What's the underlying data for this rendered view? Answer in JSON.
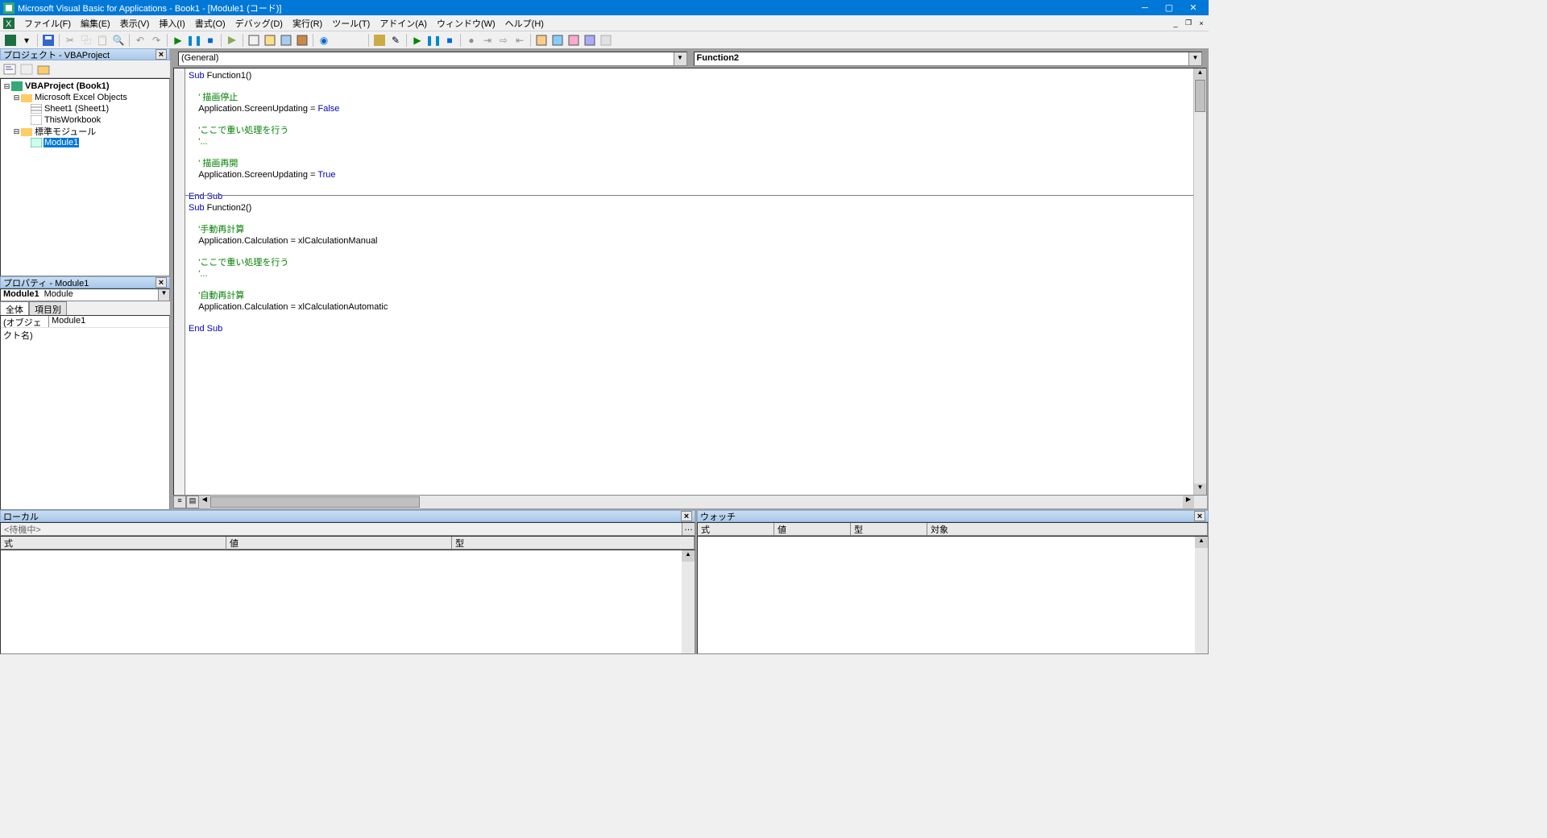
{
  "title": "Microsoft Visual Basic for Applications - Book1 - [Module1 (コード)]",
  "menu": [
    "ファイル(F)",
    "編集(E)",
    "表示(V)",
    "挿入(I)",
    "書式(O)",
    "デバッグ(D)",
    "実行(R)",
    "ツール(T)",
    "アドイン(A)",
    "ウィンドウ(W)",
    "ヘルプ(H)"
  ],
  "project": {
    "title": "プロジェクト - VBAProject",
    "root": "VBAProject (Book1)",
    "folder1": "Microsoft Excel Objects",
    "sheet1": "Sheet1 (Sheet1)",
    "thiswb": "ThisWorkbook",
    "folder2": "標準モジュール",
    "module": "Module1"
  },
  "props": {
    "title": "プロパティ - Module1",
    "name": "Module1",
    "type": "Module",
    "tab1": "全体",
    "tab2": "項目別",
    "row_key": "(オブジェクト名)",
    "row_val": "Module1"
  },
  "combo": {
    "left": "(General)",
    "right": "Function2"
  },
  "code_lines": [
    {
      "t": "kw",
      "s": "Sub"
    },
    {
      "t": "p",
      "s": " Function1()"
    },
    {
      "br": 1
    },
    {
      "br": 1
    },
    {
      "t": "sp",
      "s": "    "
    },
    {
      "t": "cm",
      "s": "' 描画停止"
    },
    {
      "br": 1
    },
    {
      "t": "sp",
      "s": "    "
    },
    {
      "t": "p",
      "s": "Application.ScreenUpdating = "
    },
    {
      "t": "kw",
      "s": "False"
    },
    {
      "br": 1
    },
    {
      "br": 1
    },
    {
      "t": "sp",
      "s": "    "
    },
    {
      "t": "cm",
      "s": "'ここで重い処理を行う"
    },
    {
      "br": 1
    },
    {
      "t": "sp",
      "s": "    "
    },
    {
      "t": "cm",
      "s": "'..."
    },
    {
      "br": 1
    },
    {
      "br": 1
    },
    {
      "t": "sp",
      "s": "    "
    },
    {
      "t": "cm",
      "s": "' 描画再開"
    },
    {
      "br": 1
    },
    {
      "t": "sp",
      "s": "    "
    },
    {
      "t": "p",
      "s": "Application.ScreenUpdating = "
    },
    {
      "t": "kw",
      "s": "True"
    },
    {
      "br": 1
    },
    {
      "br": 1
    },
    {
      "t": "kw",
      "s": "End Sub"
    },
    {
      "br": 1,
      "sep": 1
    },
    {
      "t": "kw",
      "s": "Sub"
    },
    {
      "t": "p",
      "s": " Function2()"
    },
    {
      "br": 1
    },
    {
      "br": 1
    },
    {
      "t": "sp",
      "s": "    "
    },
    {
      "t": "cm",
      "s": "'手動再計算"
    },
    {
      "br": 1
    },
    {
      "t": "sp",
      "s": "    "
    },
    {
      "t": "p",
      "s": "Application.Calculation = xlCalculationManual"
    },
    {
      "br": 1
    },
    {
      "br": 1
    },
    {
      "t": "sp",
      "s": "    "
    },
    {
      "t": "cm",
      "s": "'ここで重い処理を行う"
    },
    {
      "br": 1
    },
    {
      "t": "sp",
      "s": "    "
    },
    {
      "t": "cm",
      "s": "'..."
    },
    {
      "br": 1
    },
    {
      "br": 1
    },
    {
      "t": "sp",
      "s": "    "
    },
    {
      "t": "cm",
      "s": "'自動再計算"
    },
    {
      "br": 1
    },
    {
      "t": "sp",
      "s": "    "
    },
    {
      "t": "p",
      "s": "Application.Calculation = xlCalculationAutomatic"
    },
    {
      "br": 1
    },
    {
      "br": 1
    },
    {
      "t": "kw",
      "s": "End Sub"
    },
    {
      "br": 1
    }
  ],
  "local": {
    "title": "ローカル",
    "status": "<待機中>",
    "cols": [
      "式",
      "値",
      "型"
    ]
  },
  "watch": {
    "title": "ウォッチ",
    "cols": [
      "式",
      "値",
      "型",
      "対象"
    ]
  }
}
